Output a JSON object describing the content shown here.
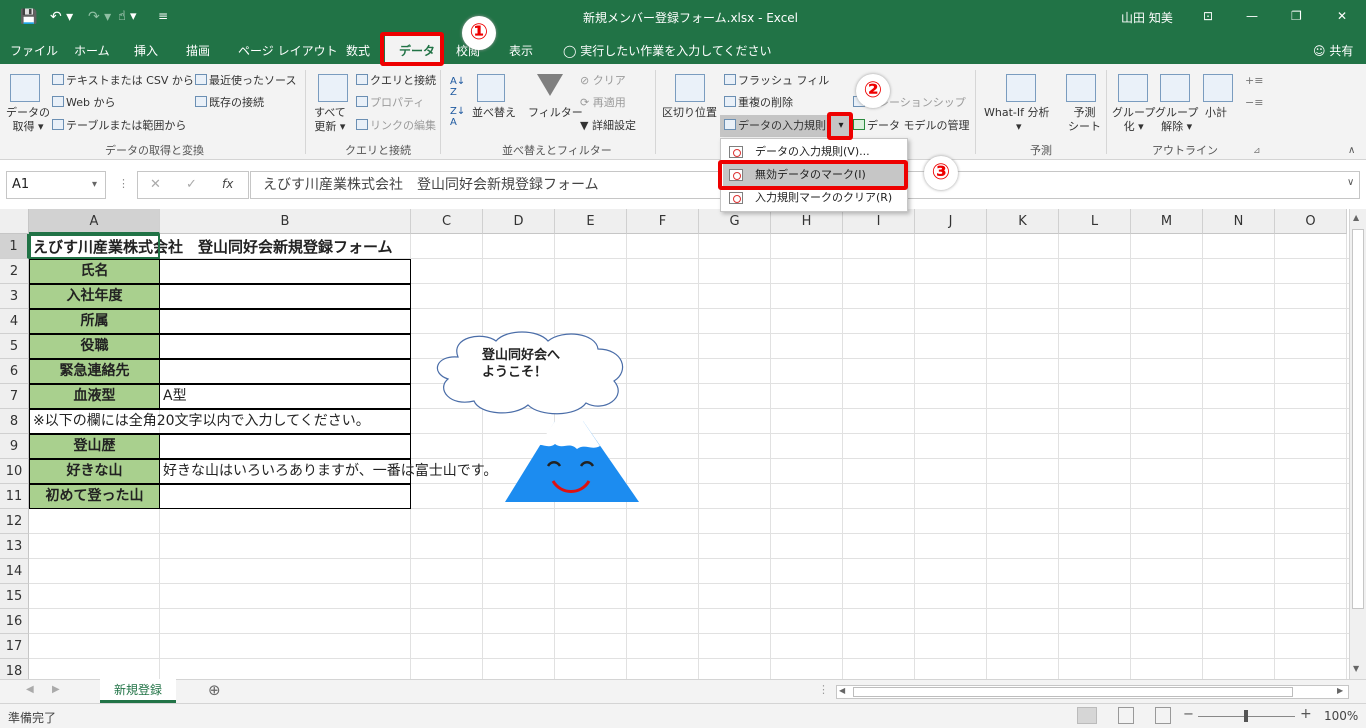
{
  "titlebar": {
    "filename": "新規メンバー登録フォーム.xlsx",
    "app": "Excel",
    "user": "山田 知美"
  },
  "tabs": [
    "ファイル",
    "ホーム",
    "挿入",
    "描画",
    "ページ レイアウト",
    "数式",
    "データ",
    "校閲",
    "表示"
  ],
  "tell_me": "実行したい作業を入力してください",
  "share": "共有",
  "ribbon": {
    "get_data": [
      "データの",
      "取得"
    ],
    "text_csv": "テキストまたは CSV から",
    "web": "Web から",
    "table_range": "テーブルまたは範囲から",
    "recent_sources": "最近使ったソース",
    "existing_conn": "既存の接続",
    "group_get": "データの取得と変換",
    "refresh_all": [
      "すべて",
      "更新"
    ],
    "queries_conn": "クエリと接続",
    "properties": "プロパティ",
    "edit_links": "リンクの編集",
    "group_queries": "クエリと接続",
    "sort": "並べ替え",
    "filter": "フィルター",
    "clear": "クリア",
    "reapply": "再適用",
    "advanced": "詳細設定",
    "group_sort": "並べ替えとフィルター",
    "text_to_columns": "区切り位置",
    "flash_fill": "フラッシュ フィル",
    "remove_dup": "重複の削除",
    "data_validation": "データの入力規則",
    "relationships": "リレーションシップ",
    "data_model": "データ モデルの管理",
    "whatif": "What-If 分析",
    "forecast": [
      "予測",
      "シート"
    ],
    "group_forecast": "予測",
    "group_btn": [
      "グループ",
      "化"
    ],
    "ungroup_btn": [
      "グループ",
      "解除"
    ],
    "subtotal": "小計",
    "group_outline": "アウトライン"
  },
  "dropdown": {
    "item1": "データの入力規則(V)...",
    "item2": "無効データのマーク(I)",
    "item3": "入力規則マークのクリア(R)"
  },
  "formula_bar": {
    "namebox": "A1",
    "fx": "fx",
    "content": "えびす川産業株式会社　登山同好会新規登録フォーム"
  },
  "columns": [
    "A",
    "B",
    "C",
    "D",
    "E",
    "F",
    "G",
    "H",
    "I",
    "J",
    "K",
    "L",
    "M",
    "N",
    "O"
  ],
  "rows": [
    "1",
    "2",
    "3",
    "4",
    "5",
    "6",
    "7",
    "8",
    "9",
    "10",
    "11",
    "12",
    "13",
    "14",
    "15",
    "16",
    "17",
    "18"
  ],
  "sheet": {
    "title": "えびす川産業株式会社　登山同好会新規登録フォーム",
    "labels": {
      "r2": "氏名",
      "r3": "入社年度",
      "r4": "所属",
      "r5": "役職",
      "r6": "緊急連絡先",
      "r7": "血液型",
      "r9": "登山歴",
      "r10": "好きな山",
      "r11": "初めて登った山"
    },
    "b7": "A型",
    "a8": "※以下の欄には全角20文字以内で入力してください。",
    "b10": "好きな山はいろいろありますが、一番は富士山です。",
    "cloud": [
      "登山同好会へ",
      "ようこそ！"
    ]
  },
  "sheet_tab": "新規登録",
  "status": "準備完了",
  "zoom": "100%",
  "callouts": [
    "①",
    "②",
    "③"
  ],
  "colors": {
    "excel_green": "#217346",
    "label_green": "#a9d08e",
    "highlight_red": "#e00000"
  }
}
